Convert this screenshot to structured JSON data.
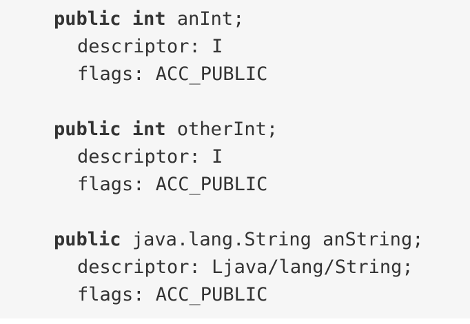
{
  "code": {
    "field1": {
      "mod": "public",
      "type_kw": "int",
      "decl": "anInt;",
      "descriptor": "descriptor: I",
      "flags": "flags: ACC_PUBLIC"
    },
    "field2": {
      "mod": "public",
      "type_kw": "int",
      "decl": "otherInt;",
      "descriptor": "descriptor: I",
      "flags": "flags: ACC_PUBLIC"
    },
    "field3": {
      "mod": "public",
      "decl": "java.lang.String anString;",
      "descriptor": "descriptor: Ljava/lang/String;",
      "flags": "flags: ACC_PUBLIC"
    }
  },
  "colors": {
    "background": "#f6f6f6",
    "text": "#333333"
  }
}
